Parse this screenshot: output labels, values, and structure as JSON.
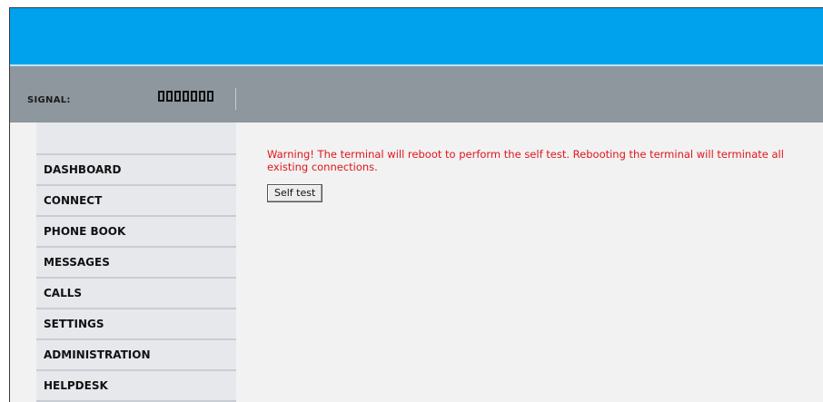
{
  "header": {
    "signal_label": "SIGNAL:",
    "signal_segments": 7
  },
  "sidebar": {
    "items": [
      {
        "label": "DASHBOARD"
      },
      {
        "label": "CONNECT"
      },
      {
        "label": "PHONE BOOK"
      },
      {
        "label": "MESSAGES"
      },
      {
        "label": "CALLS"
      },
      {
        "label": "SETTINGS"
      },
      {
        "label": "ADMINISTRATION"
      },
      {
        "label": "HELPDESK"
      }
    ]
  },
  "main": {
    "warning_text": "Warning! The terminal will reboot to perform the self test. Rebooting the terminal will terminate all existing connections.",
    "self_test_button": "Self test"
  },
  "colors": {
    "header_blue": "#00a2ee",
    "signal_bar_gray": "#8e969e",
    "sidebar_bg": "#e6e8ec",
    "warning_red": "#e0161c"
  }
}
